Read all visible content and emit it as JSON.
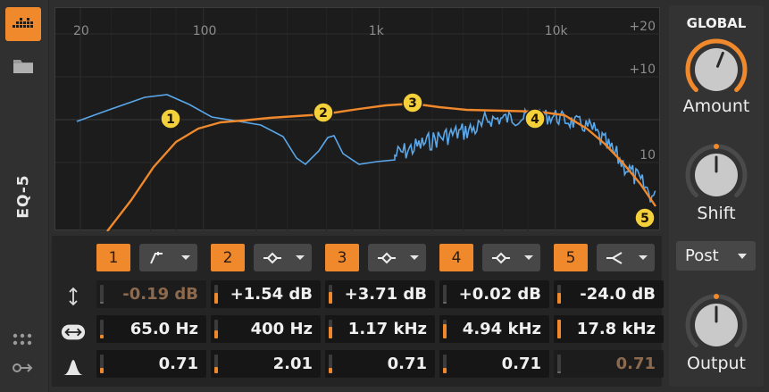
{
  "device": {
    "name": "EQ-5"
  },
  "display": {
    "freq_labels": [
      {
        "label": "20",
        "freq": 20
      },
      {
        "label": "100",
        "freq": 100
      },
      {
        "label": "1k",
        "freq": 1000
      },
      {
        "label": "10k",
        "freq": 10000
      }
    ],
    "db_labels": [
      {
        "label": "+20",
        "db": 20
      },
      {
        "label": "+10",
        "db": 10
      },
      {
        "label": "10",
        "db": -10
      }
    ],
    "curve_color": "#f0882c",
    "spectrum_color": "#5aa7ea",
    "node_color": "#f4d03a"
  },
  "bands": [
    {
      "number": "1",
      "type_icon": "low-cut-icon",
      "gain": "-0.19 dB",
      "freq": "65.0 Hz",
      "q": "0.71",
      "gain_dim": true,
      "q_dim": false,
      "gain_level": 0,
      "freq_level": 0.2,
      "q_level": 0.3
    },
    {
      "number": "2",
      "type_icon": "bell-icon",
      "gain": "+1.54 dB",
      "freq": "400 Hz",
      "q": "2.01",
      "gain_dim": false,
      "q_dim": false,
      "gain_level": 0.55,
      "freq_level": 0.45,
      "q_level": 0.35
    },
    {
      "number": "3",
      "type_icon": "bell-icon",
      "gain": "+3.71 dB",
      "freq": "1.17 kHz",
      "q": "0.71",
      "gain_dim": false,
      "q_dim": false,
      "gain_level": 0.6,
      "freq_level": 0.6,
      "q_level": 0.3
    },
    {
      "number": "4",
      "type_icon": "bell-icon",
      "gain": "+0.02 dB",
      "freq": "4.94 kHz",
      "q": "0.71",
      "gain_dim": false,
      "q_dim": false,
      "gain_level": 0,
      "freq_level": 0.75,
      "q_level": 0.3
    },
    {
      "number": "5",
      "type_icon": "high-shelf-icon",
      "gain": "-24.0 dB",
      "freq": "17.8 kHz",
      "q": "0.71",
      "gain_dim": false,
      "q_dim": true,
      "gain_level": 0.55,
      "freq_level": 1.0,
      "q_level": 0
    }
  ],
  "nodes": [
    {
      "label": "1",
      "freq": 62,
      "db": 0.5
    },
    {
      "label": "2",
      "freq": 400,
      "db": 1.5
    },
    {
      "label": "3",
      "freq": 1170,
      "db": 3.7
    },
    {
      "label": "4",
      "freq": 4940,
      "db": 0.1
    },
    {
      "label": "5",
      "freq": 17800,
      "db": -24
    }
  ],
  "global": {
    "title": "GLOBAL",
    "amount_label": "Amount",
    "shift_label": "Shift",
    "output_label": "Output",
    "mode_value": "Post",
    "amount_level": 0.58,
    "shift_level": 0.5,
    "output_level": 0.5
  }
}
